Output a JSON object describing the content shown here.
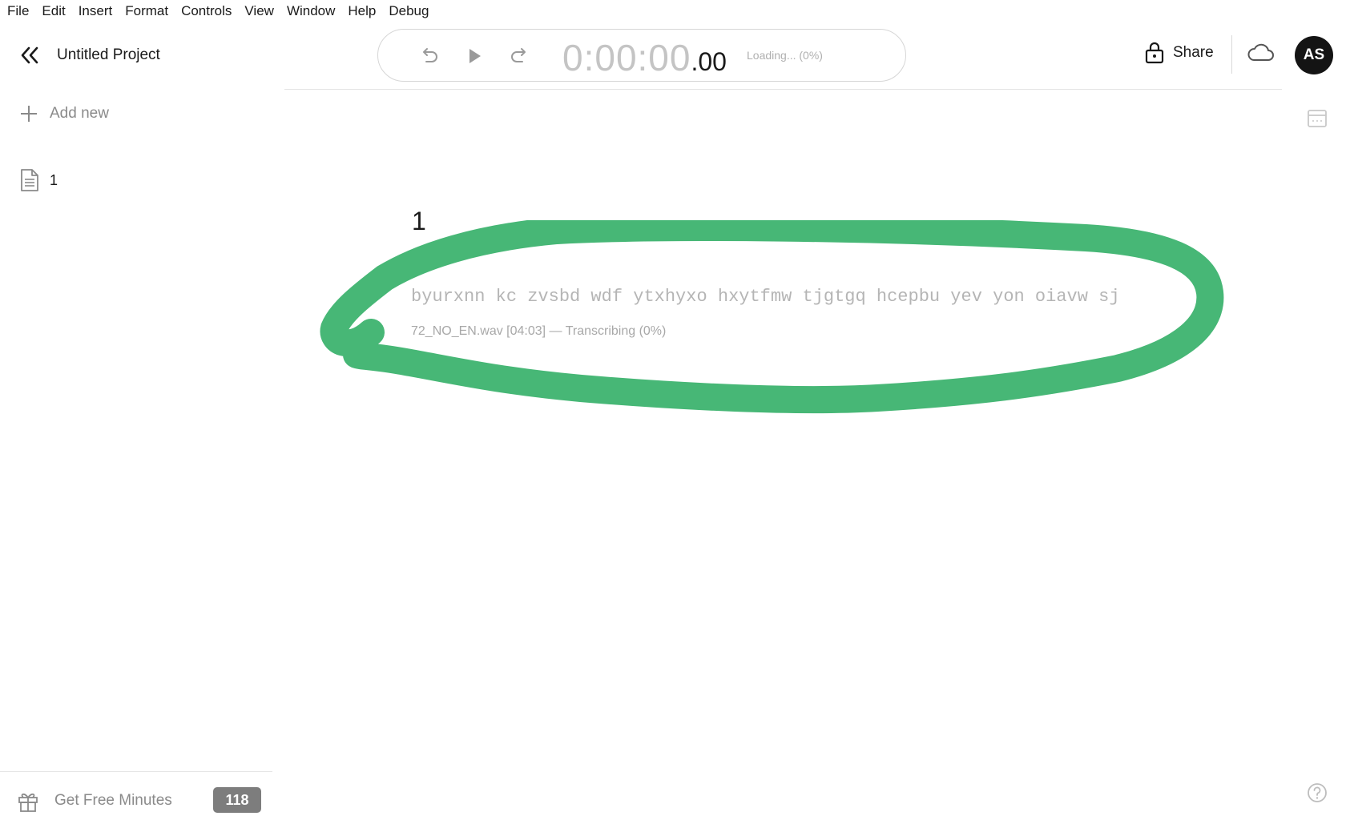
{
  "menu": [
    "File",
    "Edit",
    "Insert",
    "Format",
    "Controls",
    "View",
    "Window",
    "Help",
    "Debug"
  ],
  "project": {
    "title": "Untitled Project"
  },
  "sidebar": {
    "add_new_label": "Add new",
    "documents": [
      {
        "label": "1"
      }
    ],
    "free_minutes_label": "Get Free Minutes",
    "free_minutes_count": "118"
  },
  "transport": {
    "timecode_main": "0:00:00",
    "timecode_fraction": ".00",
    "loading_status": "Loading... (0%)"
  },
  "header": {
    "share_label": "Share",
    "avatar_initials": "AS"
  },
  "segment": {
    "number": "1",
    "text": "byurxnn kc zvsbd wdf ytxhyxo hxytfmw tjgtgq hcepbu yev yon oiavw sj",
    "meta": "72_NO_EN.wav [04:03] — Transcribing (0%)"
  },
  "colors": {
    "annotation_stroke": "#47b776",
    "avatar_bg": "#141414",
    "badge_bg": "#7d7d7d"
  },
  "icons": {
    "collapse": "double-chevron-left-icon",
    "add": "plus-icon",
    "document": "document-icon",
    "gift": "gift-icon",
    "undo": "rewind-icon",
    "play": "play-icon",
    "redo": "forward-icon",
    "lock": "lock-icon",
    "cloud": "cloud-icon",
    "calendar": "calendar-icon",
    "help": "help-icon"
  }
}
